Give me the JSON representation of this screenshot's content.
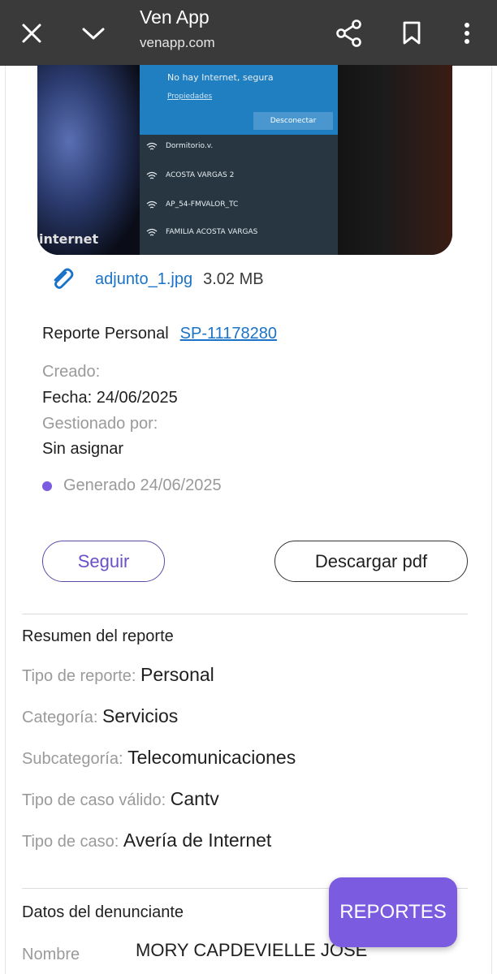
{
  "browser": {
    "title": "Ven App",
    "url": "venapp.com",
    "icons": [
      "close-icon",
      "chevron-down-icon",
      "share-icon",
      "bookmark-icon",
      "more-vertical-icon"
    ]
  },
  "photo": {
    "wifi_status": "No hay Internet, segura",
    "properties_link": "Propiedades",
    "disconnect_button": "Desconectar",
    "networks": [
      "Dormitorio.v.",
      "ACOSTA VARGAS 2",
      "AP_54-FMVALOR_TC",
      "FAMILIA ACOSTA VARGAS"
    ],
    "corner_text": "internet"
  },
  "attachment": {
    "filename": "adjunto_1.jpg",
    "size": "3.02 MB",
    "icon": "paperclip-icon"
  },
  "report": {
    "type_label": "Reporte Personal",
    "id": "SP-11178280",
    "created_label": "Creado:",
    "date": "Fecha: 24/06/2025",
    "managed_label": "Gestionado por:",
    "managed_value": "Sin asignar",
    "status": "Generado 24/06/2025",
    "status_color": "#7b5ce0"
  },
  "actions": {
    "follow": "Seguir",
    "download": "Descargar pdf"
  },
  "summary": {
    "title": "Resumen del reporte",
    "rows": [
      {
        "key": "Tipo de reporte:",
        "value": "Personal"
      },
      {
        "key": "Categoría:",
        "value": "Servicios"
      },
      {
        "key": "Subcategoría:",
        "value": "Telecomunicaciones"
      },
      {
        "key": "Tipo de caso válido:",
        "value": "Cantv"
      },
      {
        "key": "Tipo de caso:",
        "value": "Avería de Internet"
      }
    ]
  },
  "complainant": {
    "title": "Datos del denunciante",
    "name_label": "Nombre",
    "name_value": "MORY CAPDEVIELLE JOSE"
  },
  "fab": {
    "label": "REPORTES",
    "color": "#7b5ce0"
  }
}
